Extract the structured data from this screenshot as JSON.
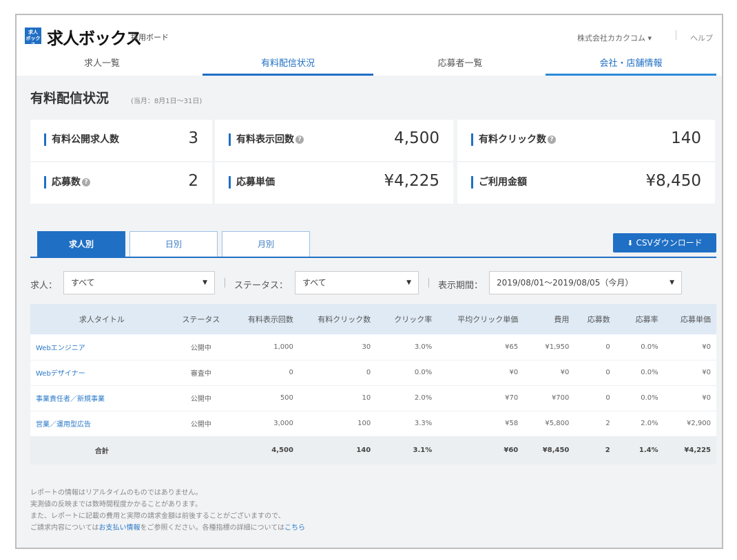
{
  "header": {
    "logo_mark": "求人\nボックス",
    "logo_text": "求人ボックス",
    "logo_sub": "採用ボード",
    "company": "株式会社カカクコム ▾",
    "help": "ヘルプ"
  },
  "nav": {
    "tabs": [
      {
        "label": "求人一覧"
      },
      {
        "label": "有料配信状況"
      },
      {
        "label": "応募者一覧"
      },
      {
        "label": "会社・店舗情報"
      }
    ]
  },
  "page": {
    "title": "有料配信状況",
    "period": "(当月：8月1日〜31日)"
  },
  "stats": [
    {
      "label": "有料公開求人数",
      "value": "3",
      "help": false
    },
    {
      "label": "有料表示回数",
      "value": "4,500",
      "help": true
    },
    {
      "label": "有料クリック数",
      "value": "140",
      "help": true
    },
    {
      "label": "応募数",
      "value": "2",
      "help": true
    },
    {
      "label": "応募単価",
      "value": "¥4,225",
      "help": false
    },
    {
      "label": "ご利用金額",
      "value": "¥8,450",
      "help": false
    }
  ],
  "subtabs": [
    {
      "label": "求人別"
    },
    {
      "label": "日別"
    },
    {
      "label": "月別"
    }
  ],
  "csv_button": "CSVダウンロード",
  "filters": {
    "job_label": "求人：",
    "job_value": "すべて",
    "status_label": "ステータス：",
    "status_value": "すべて",
    "period_label": "表示期間：",
    "period_value": "2019/08/01〜2019/08/05（今月）"
  },
  "table": {
    "headers": [
      "求人タイトル",
      "ステータス",
      "有料表示回数",
      "有料クリック数",
      "クリック率",
      "平均クリック単価",
      "費用",
      "応募数",
      "応募率",
      "応募単価"
    ],
    "rows": [
      [
        "Webエンジニア",
        "公開中",
        "1,000",
        "30",
        "3.0%",
        "¥65",
        "¥1,950",
        "0",
        "0.0%",
        "¥0"
      ],
      [
        "Webデザイナー",
        "審査中",
        "0",
        "0",
        "0.0%",
        "¥0",
        "¥0",
        "0",
        "0.0%",
        "¥0"
      ],
      [
        "事業責任者／新規事業",
        "公開中",
        "500",
        "10",
        "2.0%",
        "¥70",
        "¥700",
        "0",
        "0.0%",
        "¥0"
      ],
      [
        "営業／運用型広告",
        "公開中",
        "3,000",
        "100",
        "3.3%",
        "¥58",
        "¥5,800",
        "2",
        "2.0%",
        "¥2,900"
      ]
    ],
    "total": [
      "合計",
      "",
      "4,500",
      "140",
      "3.1%",
      "¥60",
      "¥8,450",
      "2",
      "1.4%",
      "¥4,225"
    ]
  },
  "notes": {
    "line1": "レポートの情報はリアルタイムのものではありません。",
    "line2": "実測値の反映までは数時間程度かかることがあります。",
    "line3": "また、レポートに記載の費用と実際の請求金額は前後することがございますので、",
    "line4_a": "ご請求内容については",
    "line4_link1": "お支払い情報",
    "line4_b": "をご参照ください。各種指標の詳細については",
    "line4_link2": "こちら"
  },
  "colors": {
    "accent": "#1f6fc4",
    "header_bg": "#dfeaf5",
    "page_bg": "#f1f3f5"
  }
}
